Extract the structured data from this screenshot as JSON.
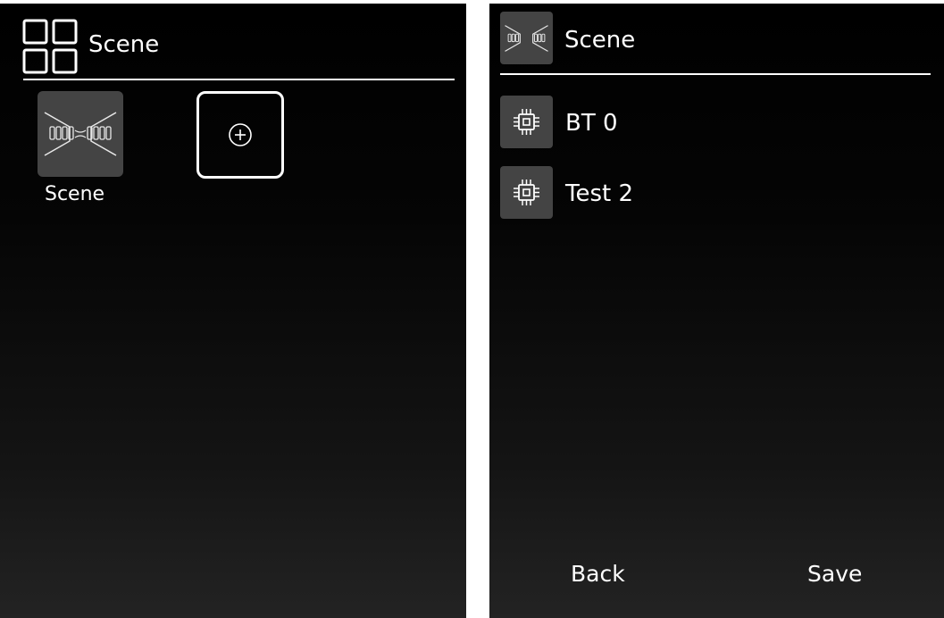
{
  "left_screen": {
    "header": {
      "title": "Scene",
      "icon": "grid-four-icon"
    },
    "tiles": [
      {
        "label": "Scene",
        "icon": "scene-lights-icon"
      },
      {
        "icon": "plus-circle-icon"
      }
    ]
  },
  "right_screen": {
    "header": {
      "title": "Scene",
      "icon": "scene-lights-icon"
    },
    "devices": [
      {
        "label": "BT 0",
        "icon": "chip-icon"
      },
      {
        "label": "Test 2",
        "icon": "chip-icon"
      }
    ],
    "footer": {
      "back_label": "Back",
      "save_label": "Save"
    }
  },
  "colors": {
    "background_top": "#000000",
    "background_bottom": "#232323",
    "tile_bg": "#444444",
    "text": "#ffffff"
  }
}
